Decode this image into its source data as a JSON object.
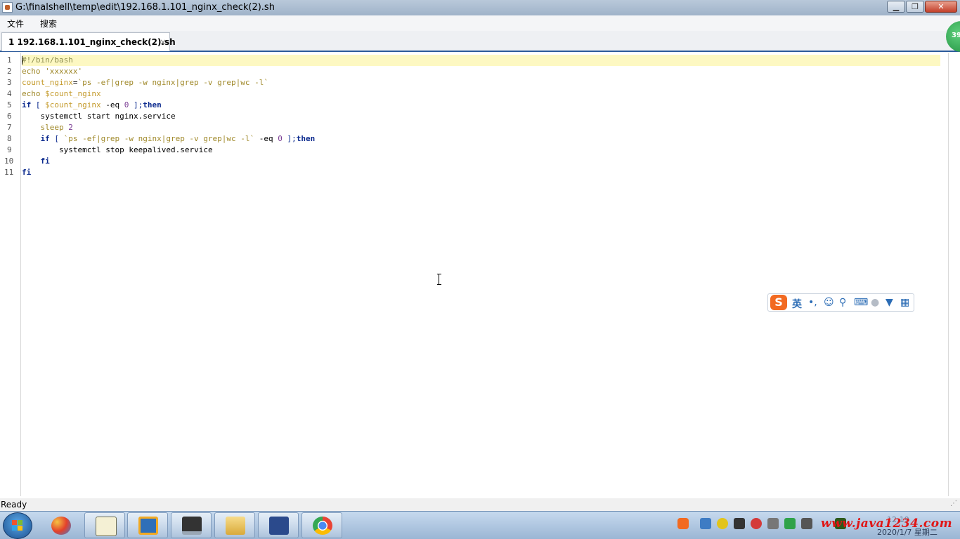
{
  "window": {
    "title": "G:\\finalshell\\temp\\edit\\192.168.1.101_nginx_check(2).sh"
  },
  "window_controls": {
    "minimize": "▁",
    "maximize": "❐",
    "close": "✕"
  },
  "menu": {
    "file": "文件",
    "search": "搜索"
  },
  "tab": {
    "label": "1 192.168.1.101_nginx_check(2).sh",
    "close": "×"
  },
  "badge": {
    "value": "39"
  },
  "editor": {
    "line_numbers": [
      "1",
      "2",
      "3",
      "4",
      "5",
      "6",
      "7",
      "8",
      "9",
      "10",
      "11"
    ],
    "lines": [
      "#!/bin/bash",
      "echo 'xxxxxx'",
      "count_nginx=`ps -ef|grep -w nginx|grep -v grep|wc -l`",
      "echo $count_nginx",
      "if [ $count_nginx -eq 0 ];then",
      "    systemctl start nginx.service",
      "    sleep 2",
      "    if [ `ps -ef|grep -w nginx|grep -v grep|wc -l` -eq 0 ];then",
      "        systemctl stop keepalived.service",
      "    fi",
      "fi"
    ]
  },
  "ime": {
    "logo": "S",
    "mode": "英",
    "punct": "•,",
    "items": [
      "smile-icon",
      "mic-icon",
      "keyboard-icon",
      "user-icon",
      "shirt-icon",
      "grid-icon"
    ]
  },
  "status": {
    "text": "Ready"
  },
  "taskbar": {
    "apps": [
      "start-button",
      "colors-app",
      "notepad-app",
      "vmware-app",
      "remote-desktop-app",
      "file-explorer-app",
      "xshell-app",
      "chrome-app"
    ],
    "watermark": "www.java1234.com",
    "time": "12:19",
    "date": "2020/1/7 星期二"
  },
  "colors": {
    "accent": "#2b5a9a",
    "current_line": "#fdf8c2",
    "keyword": "#0b2a8e",
    "builtin": "#a0892a"
  }
}
